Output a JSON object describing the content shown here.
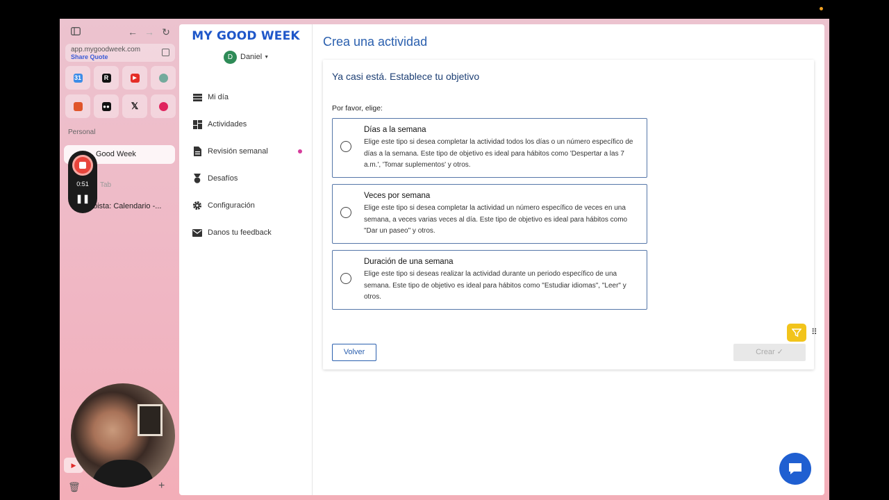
{
  "browser": {
    "url": "app.mygoodweek.com",
    "url_subtitle": "Share Quote",
    "section_label": "Personal",
    "active_tab": "Good Week",
    "new_tab": "Tab",
    "calendar_tab": "bista: Calendario -...",
    "recording_time": "0:51"
  },
  "app": {
    "logo": "MY GOOD WEEK",
    "user_initial": "D",
    "user_name": "Daniel",
    "nav": [
      {
        "label": "Mi día",
        "icon": "menu-icon"
      },
      {
        "label": "Actividades",
        "icon": "dashboard-icon"
      },
      {
        "label": "Revisión semanal",
        "icon": "document-icon"
      },
      {
        "label": "Desafíos",
        "icon": "medal-icon"
      },
      {
        "label": "Configuración",
        "icon": "gear-icon"
      },
      {
        "label": "Danos tu feedback",
        "icon": "mail-icon"
      }
    ],
    "page_title": "Crea una actividad",
    "card_title": "Ya casi está. Establece tu objetivo",
    "prompt": "Por favor, elige:",
    "options": [
      {
        "title": "Días a la semana",
        "description": "Elige este tipo si desea completar la actividad todos los días o un número específico de días a la semana. Este tipo de objetivo es ideal para hábitos como 'Despertar a las 7 a.m.', 'Tomar suplementos' y otros."
      },
      {
        "title": "Veces por semana",
        "description": "Elige este tipo si desea completar la actividad un número específico de veces en una semana, a veces varias veces al día. Este tipo de objetivo es ideal para hábitos como \"Dar un paseo\" y otros."
      },
      {
        "title": "Duración de una semana",
        "description": "Elige este tipo si deseas realizar la actividad durante un periodo específico de una semana. Este tipo de objetivo es ideal para hábitos como \"Estudiar idiomas\", \"Leer\" y otros."
      }
    ],
    "back_label": "Volver",
    "create_label": "Crear ✓"
  },
  "colors": {
    "accent": "#2a5fae",
    "logo": "#1f57c9",
    "chat": "#1f5fd1",
    "dot": "#d63d9c"
  }
}
